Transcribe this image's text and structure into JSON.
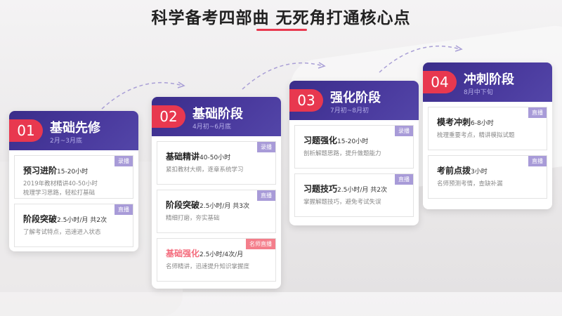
{
  "title": "科学备考四部曲 无死角打通核心点",
  "colors": {
    "accent": "#e8384f",
    "header": "#3a2d8a",
    "badge": "#a89bd8",
    "badge_highlight": "#f47e8b"
  },
  "stages": [
    {
      "num": "01",
      "name": "基础先修",
      "date": "2月~3月底",
      "items": [
        {
          "title": "预习进阶",
          "meta": "15-20小时",
          "badge": "录播",
          "desc": [
            "2019年教材精讲40-50小时",
            "梳理学习思路，轻松打基础"
          ]
        },
        {
          "title": "阶段突破",
          "meta": "2.5小时/月 共2次",
          "badge": "直播",
          "desc": [
            "了解考试特点，迅速进入状态"
          ]
        }
      ]
    },
    {
      "num": "02",
      "name": "基础阶段",
      "date": "4月初~6月底",
      "items": [
        {
          "title": "基础精讲",
          "meta": "40-50小时",
          "badge": "录播",
          "desc": [
            "紧扣教材大纲，逐章系统学习"
          ]
        },
        {
          "title": "阶段突破",
          "meta": "2.5小时/月 共3次",
          "badge": "直播",
          "desc": [
            "精细打磨，夯实基础"
          ]
        },
        {
          "title": "基础强化",
          "meta": "2.5小时/4次/月",
          "badge": "名师直播",
          "desc": [
            "名师精讲，迅速提升知识掌握度"
          ],
          "highlight": true
        }
      ]
    },
    {
      "num": "03",
      "name": "强化阶段",
      "date": "7月初~8月初",
      "items": [
        {
          "title": "习题强化",
          "meta": "15-20小时",
          "badge": "录播",
          "desc": [
            "剖析解题思路，提升做题能力"
          ]
        },
        {
          "title": "习题技巧",
          "meta": "2.5小时/月 共2次",
          "badge": "直播",
          "desc": [
            "掌握解题技巧，避免考试失误"
          ]
        }
      ]
    },
    {
      "num": "04",
      "name": "冲刺阶段",
      "date": "8月中下旬",
      "items": [
        {
          "title": "模考冲刺",
          "meta": "6-8小时",
          "badge": "直播",
          "desc": [
            "梳理重要考点，精讲模拟试题"
          ]
        },
        {
          "title": "考前点拨",
          "meta": "3小时",
          "badge": "直播",
          "desc": [
            "名师预测考情，查缺补漏"
          ]
        }
      ]
    }
  ]
}
